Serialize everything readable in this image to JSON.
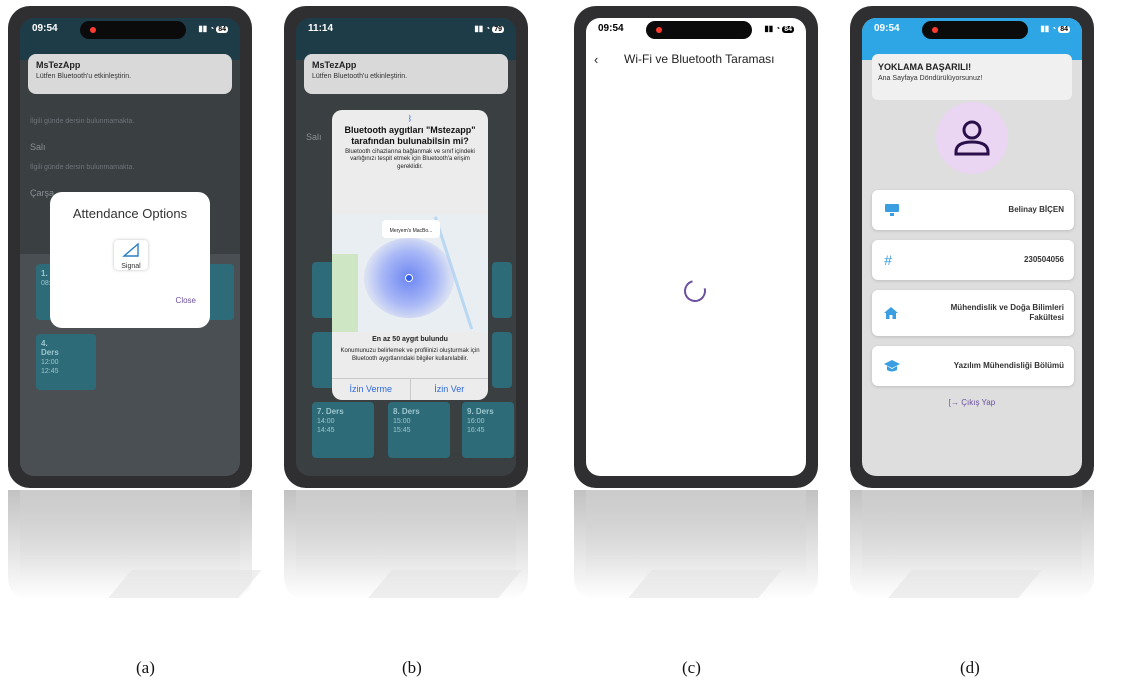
{
  "captions": {
    "a": "(a)",
    "b": "(b)",
    "c": "(c)",
    "d": "(d)"
  },
  "phone_a": {
    "time": "09:54",
    "battery": "84",
    "notification_title": "MsTezApp",
    "notification_body": "Lütfen Bluetooth'u etkinleştirin.",
    "empty_day_text": "İlgili günde dersin bulunmamakta.",
    "day_sali": "Salı",
    "empty_day_text_2": "İlgili günde dersin bulunmamakta.",
    "day_carsamba": "Çarşa",
    "modal_title": "Attendance Options",
    "signal_label": "Signal",
    "close_label": "Close",
    "lesson_1_title": "1.",
    "lesson_1_time": "08:",
    "lesson_4_title": "4.",
    "lesson_4_sub": "Ders",
    "lesson_4_start": "12:00",
    "lesson_4_end": "12:45"
  },
  "phone_b": {
    "time": "11:14",
    "battery": "79",
    "notification_title": "MsTezApp",
    "notification_body": "Lütfen Bluetooth'u etkinleştirin.",
    "day_sali": "Salı",
    "dialog_title": "Bluetooth aygıtları \"Mstezapp\" tarafından bulunabilsin mi?",
    "dialog_desc": "Bluetooth cihazlarına bağlanmak ve sınıf içindeki varlığınızı tespit etmek için Bluetooth'a erişim gereklidir.",
    "map_pin": "Meryem's MacBo...",
    "found_title": "En az 50 aygıt bulundu",
    "found_desc": "Konumunuzu belirlemek ve profilinizi oluşturmak için Bluetooth aygıtlarındaki bilgiler kullanılabilir.",
    "deny_label": "İzin Verme",
    "allow_label": "İzin Ver",
    "lesson_7_title": "7. Ders",
    "lesson_7_start": "14:00",
    "lesson_7_end": "14:45",
    "lesson_8_title": "8. Ders",
    "lesson_8_start": "15:00",
    "lesson_8_end": "15:45",
    "lesson_9_title": "9. Ders",
    "lesson_9_start": "16:00",
    "lesson_9_end": "16:45"
  },
  "phone_c": {
    "time": "09:54",
    "battery": "84",
    "title": "Wi-Fi ve Bluetooth Taraması"
  },
  "phone_d": {
    "time": "09:54",
    "battery": "84",
    "toast_title": "YOKLAMA BAŞARILI!",
    "toast_body": "Ana Sayfaya Döndürülüyorsunuz!",
    "name": "Belinay BİÇEN",
    "student_no": "230504056",
    "faculty": "Mühendislik ve Doğa Bilimleri Fakültesi",
    "department": "Yazılım Mühendisliği Bölümü",
    "logout_label": "Çıkış Yap"
  },
  "colors": {
    "accent": "#6b4fa0",
    "lesson_tile": "#2e6b78",
    "ios_blue": "#2f6bdc",
    "avatar_bg": "#ead6f3"
  }
}
